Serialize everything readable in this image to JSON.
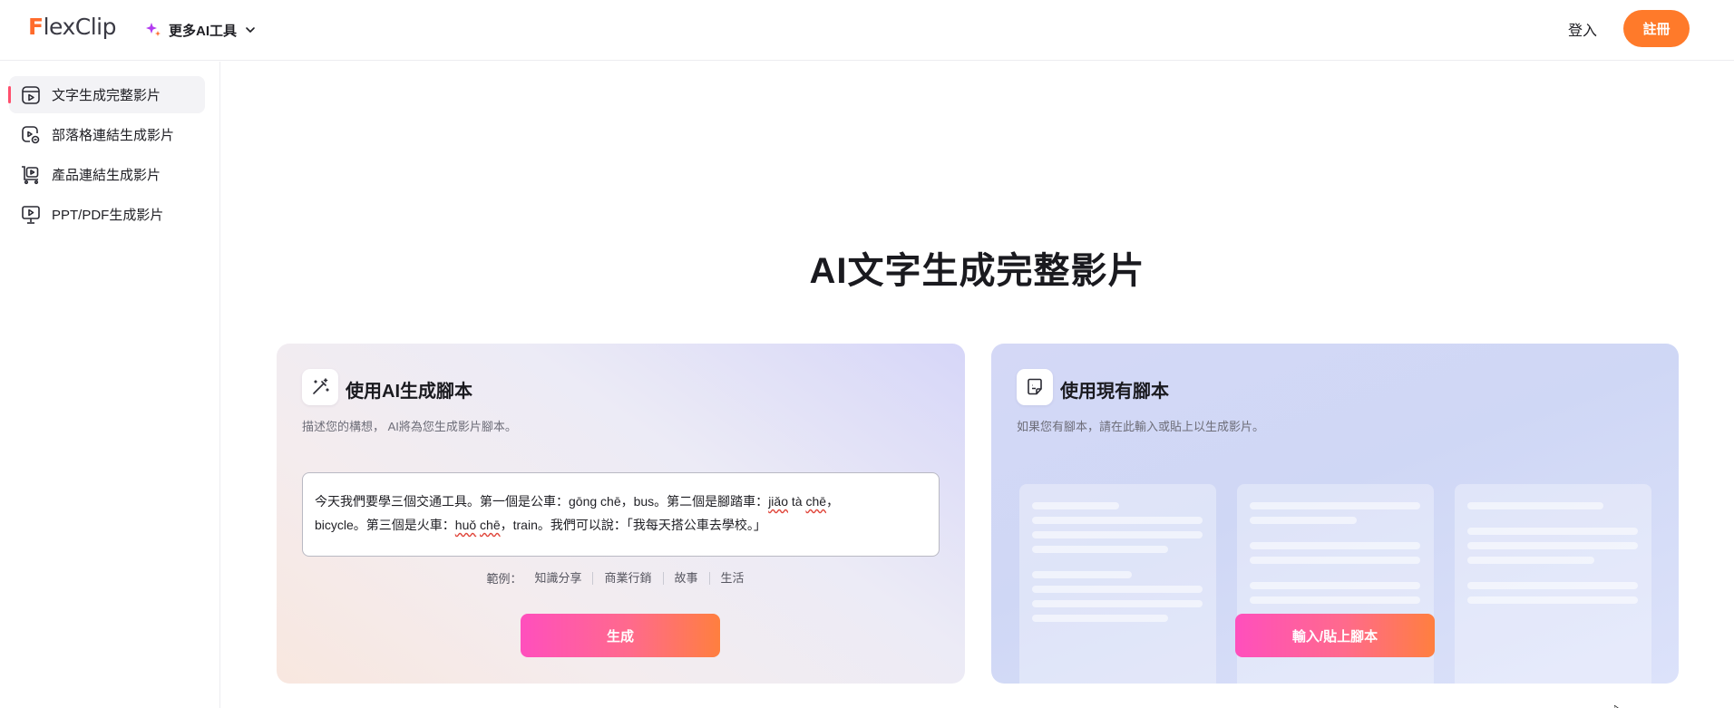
{
  "header": {
    "logo_first": "F",
    "logo_rest": "lexClip",
    "more_ai_tools": "更多AI工具",
    "login": "登入",
    "signup": "註冊"
  },
  "sidebar": {
    "items": [
      {
        "label": "文字生成完整影片",
        "active": true
      },
      {
        "label": "部落格連結生成影片",
        "active": false
      },
      {
        "label": "產品連結生成影片",
        "active": false
      },
      {
        "label": "PPT/PDF生成影片",
        "active": false
      }
    ]
  },
  "main": {
    "title": "AI文字生成完整影片",
    "ai_card": {
      "title": "使用AI生成腳本",
      "description": "描述您的構想， AI將為您生成影片腳本。",
      "script_line1_a": "今天我們要學三個交通工具。第一個是公車：gōng chē，bus。第二個是腳踏車：",
      "script_line1_w1": "jiǎo",
      "script_line1_b": " tà ",
      "script_line1_w2": "chē",
      "script_line1_c": "，",
      "script_line2_a": "bicycle。第三個是火車：",
      "script_line2_w1": "huǒ",
      "script_line2_b": " ",
      "script_line2_w2": "chē",
      "script_line2_c": "，train。我們可以說：「我每天搭公車去學校。」",
      "examples_label": "範例：",
      "examples": [
        "知識分享",
        "商業行銷",
        "故事",
        "生活"
      ],
      "generate_button": "生成"
    },
    "existing_card": {
      "title": "使用現有腳本",
      "description": "如果您有腳本，請在此輸入或貼上以生成影片。",
      "paste_button": "輸入/貼上腳本"
    }
  },
  "colors": {
    "accent_orange": "#ff7a2a",
    "active_indicator": "#ff4f6d",
    "button_gradient_start": "#ff4fbd",
    "button_gradient_end": "#ff7f3f"
  }
}
